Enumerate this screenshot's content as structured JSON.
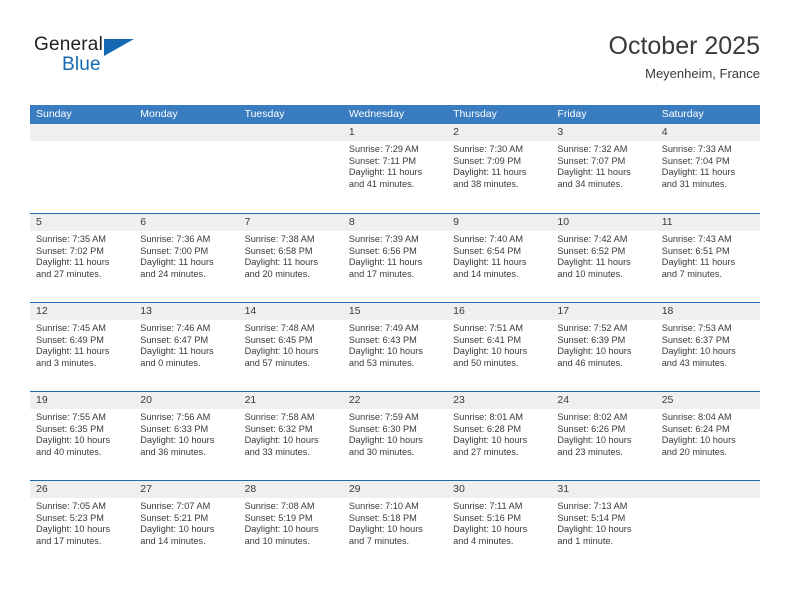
{
  "brand": {
    "name_top": "General",
    "name_bottom": "Blue",
    "triangle_icon": "blue-triangle-logo-mark",
    "accent_color": "#1569b4"
  },
  "header": {
    "title": "October 2025",
    "subtitle": "Meyenheim, France"
  },
  "colors": {
    "header_row_bg": "#3a7cc0",
    "week_divider": "#1f6bb0",
    "date_strip_bg": "#efefef",
    "text": "#3a3a3a"
  },
  "weekdays": [
    "Sunday",
    "Monday",
    "Tuesday",
    "Wednesday",
    "Thursday",
    "Friday",
    "Saturday"
  ],
  "weeks": [
    [
      {
        "day": "",
        "lines": []
      },
      {
        "day": "",
        "lines": []
      },
      {
        "day": "",
        "lines": []
      },
      {
        "day": "1",
        "lines": [
          "Sunrise: 7:29 AM",
          "Sunset: 7:11 PM",
          "Daylight: 11 hours",
          "and 41 minutes."
        ]
      },
      {
        "day": "2",
        "lines": [
          "Sunrise: 7:30 AM",
          "Sunset: 7:09 PM",
          "Daylight: 11 hours",
          "and 38 minutes."
        ]
      },
      {
        "day": "3",
        "lines": [
          "Sunrise: 7:32 AM",
          "Sunset: 7:07 PM",
          "Daylight: 11 hours",
          "and 34 minutes."
        ]
      },
      {
        "day": "4",
        "lines": [
          "Sunrise: 7:33 AM",
          "Sunset: 7:04 PM",
          "Daylight: 11 hours",
          "and 31 minutes."
        ]
      }
    ],
    [
      {
        "day": "5",
        "lines": [
          "Sunrise: 7:35 AM",
          "Sunset: 7:02 PM",
          "Daylight: 11 hours",
          "and 27 minutes."
        ]
      },
      {
        "day": "6",
        "lines": [
          "Sunrise: 7:36 AM",
          "Sunset: 7:00 PM",
          "Daylight: 11 hours",
          "and 24 minutes."
        ]
      },
      {
        "day": "7",
        "lines": [
          "Sunrise: 7:38 AM",
          "Sunset: 6:58 PM",
          "Daylight: 11 hours",
          "and 20 minutes."
        ]
      },
      {
        "day": "8",
        "lines": [
          "Sunrise: 7:39 AM",
          "Sunset: 6:56 PM",
          "Daylight: 11 hours",
          "and 17 minutes."
        ]
      },
      {
        "day": "9",
        "lines": [
          "Sunrise: 7:40 AM",
          "Sunset: 6:54 PM",
          "Daylight: 11 hours",
          "and 14 minutes."
        ]
      },
      {
        "day": "10",
        "lines": [
          "Sunrise: 7:42 AM",
          "Sunset: 6:52 PM",
          "Daylight: 11 hours",
          "and 10 minutes."
        ]
      },
      {
        "day": "11",
        "lines": [
          "Sunrise: 7:43 AM",
          "Sunset: 6:51 PM",
          "Daylight: 11 hours",
          "and 7 minutes."
        ]
      }
    ],
    [
      {
        "day": "12",
        "lines": [
          "Sunrise: 7:45 AM",
          "Sunset: 6:49 PM",
          "Daylight: 11 hours",
          "and 3 minutes."
        ]
      },
      {
        "day": "13",
        "lines": [
          "Sunrise: 7:46 AM",
          "Sunset: 6:47 PM",
          "Daylight: 11 hours",
          "and 0 minutes."
        ]
      },
      {
        "day": "14",
        "lines": [
          "Sunrise: 7:48 AM",
          "Sunset: 6:45 PM",
          "Daylight: 10 hours",
          "and 57 minutes."
        ]
      },
      {
        "day": "15",
        "lines": [
          "Sunrise: 7:49 AM",
          "Sunset: 6:43 PM",
          "Daylight: 10 hours",
          "and 53 minutes."
        ]
      },
      {
        "day": "16",
        "lines": [
          "Sunrise: 7:51 AM",
          "Sunset: 6:41 PM",
          "Daylight: 10 hours",
          "and 50 minutes."
        ]
      },
      {
        "day": "17",
        "lines": [
          "Sunrise: 7:52 AM",
          "Sunset: 6:39 PM",
          "Daylight: 10 hours",
          "and 46 minutes."
        ]
      },
      {
        "day": "18",
        "lines": [
          "Sunrise: 7:53 AM",
          "Sunset: 6:37 PM",
          "Daylight: 10 hours",
          "and 43 minutes."
        ]
      }
    ],
    [
      {
        "day": "19",
        "lines": [
          "Sunrise: 7:55 AM",
          "Sunset: 6:35 PM",
          "Daylight: 10 hours",
          "and 40 minutes."
        ]
      },
      {
        "day": "20",
        "lines": [
          "Sunrise: 7:56 AM",
          "Sunset: 6:33 PM",
          "Daylight: 10 hours",
          "and 36 minutes."
        ]
      },
      {
        "day": "21",
        "lines": [
          "Sunrise: 7:58 AM",
          "Sunset: 6:32 PM",
          "Daylight: 10 hours",
          "and 33 minutes."
        ]
      },
      {
        "day": "22",
        "lines": [
          "Sunrise: 7:59 AM",
          "Sunset: 6:30 PM",
          "Daylight: 10 hours",
          "and 30 minutes."
        ]
      },
      {
        "day": "23",
        "lines": [
          "Sunrise: 8:01 AM",
          "Sunset: 6:28 PM",
          "Daylight: 10 hours",
          "and 27 minutes."
        ]
      },
      {
        "day": "24",
        "lines": [
          "Sunrise: 8:02 AM",
          "Sunset: 6:26 PM",
          "Daylight: 10 hours",
          "and 23 minutes."
        ]
      },
      {
        "day": "25",
        "lines": [
          "Sunrise: 8:04 AM",
          "Sunset: 6:24 PM",
          "Daylight: 10 hours",
          "and 20 minutes."
        ]
      }
    ],
    [
      {
        "day": "26",
        "lines": [
          "Sunrise: 7:05 AM",
          "Sunset: 5:23 PM",
          "Daylight: 10 hours",
          "and 17 minutes."
        ]
      },
      {
        "day": "27",
        "lines": [
          "Sunrise: 7:07 AM",
          "Sunset: 5:21 PM",
          "Daylight: 10 hours",
          "and 14 minutes."
        ]
      },
      {
        "day": "28",
        "lines": [
          "Sunrise: 7:08 AM",
          "Sunset: 5:19 PM",
          "Daylight: 10 hours",
          "and 10 minutes."
        ]
      },
      {
        "day": "29",
        "lines": [
          "Sunrise: 7:10 AM",
          "Sunset: 5:18 PM",
          "Daylight: 10 hours",
          "and 7 minutes."
        ]
      },
      {
        "day": "30",
        "lines": [
          "Sunrise: 7:11 AM",
          "Sunset: 5:16 PM",
          "Daylight: 10 hours",
          "and 4 minutes."
        ]
      },
      {
        "day": "31",
        "lines": [
          "Sunrise: 7:13 AM",
          "Sunset: 5:14 PM",
          "Daylight: 10 hours",
          "and 1 minute."
        ]
      },
      {
        "day": "",
        "lines": []
      }
    ]
  ]
}
